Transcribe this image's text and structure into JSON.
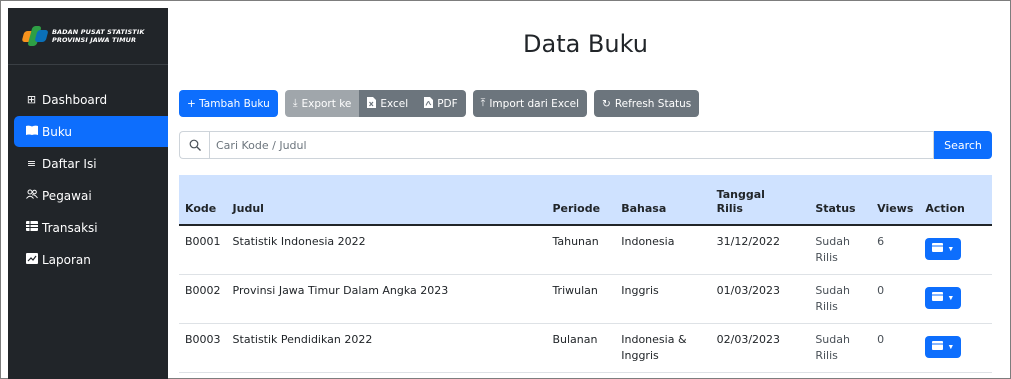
{
  "brand": {
    "line1": "BADAN PUSAT STATISTIK",
    "line2": "PROVINSI JAWA TIMUR",
    "logo_colors": [
      "#f7931d",
      "#2e9f45",
      "#0a70b8"
    ]
  },
  "sidebar": {
    "items": [
      {
        "label": "Dashboard",
        "icon": "grid-icon",
        "glyph": "⊞"
      },
      {
        "label": "Buku",
        "icon": "book-icon",
        "glyph": "▀"
      },
      {
        "label": "Daftar Isi",
        "icon": "list-icon",
        "glyph": "≡"
      },
      {
        "label": "Pegawai",
        "icon": "people-icon",
        "glyph": "👥"
      },
      {
        "label": "Transaksi",
        "icon": "table-icon",
        "glyph": "▤"
      },
      {
        "label": "Laporan",
        "icon": "report-icon",
        "glyph": "◪"
      }
    ],
    "active_index": 1
  },
  "page": {
    "title": "Data Buku"
  },
  "toolbar": {
    "add_label": "+ Tambah Buku",
    "export_label": "Export ke",
    "excel_label": "Excel",
    "pdf_label": "PDF",
    "import_label": "Import dari Excel",
    "refresh_label": "Refresh Status"
  },
  "search": {
    "placeholder": "Cari Kode / Judul",
    "button_label": "Search"
  },
  "table": {
    "headers": [
      "Kode",
      "Judul",
      "Periode",
      "Bahasa",
      "Tanggal Rilis",
      "Status",
      "Views",
      "Action"
    ],
    "rows": [
      {
        "kode": "B0001",
        "judul": "Statistik Indonesia 2022",
        "periode": "Tahunan",
        "bahasa": "Indonesia",
        "tanggal": "31/12/2022",
        "status": "Sudah Rilis",
        "views": "6"
      },
      {
        "kode": "B0002",
        "judul": "Provinsi Jawa Timur Dalam Angka 2023",
        "periode": "Triwulan",
        "bahasa": "Inggris",
        "tanggal": "01/03/2023",
        "status": "Sudah Rilis",
        "views": "0"
      },
      {
        "kode": "B0003",
        "judul": "Statistik Pendidikan 2022",
        "periode": "Bulanan",
        "bahasa": "Indonesia & Inggris",
        "tanggal": "02/03/2023",
        "status": "Sudah Rilis",
        "views": "0"
      }
    ]
  },
  "colors": {
    "primary": "#0d6efd",
    "sidebar_bg": "#212529",
    "table_header_bg": "#cfe2ff",
    "secondary": "#6c757d"
  }
}
